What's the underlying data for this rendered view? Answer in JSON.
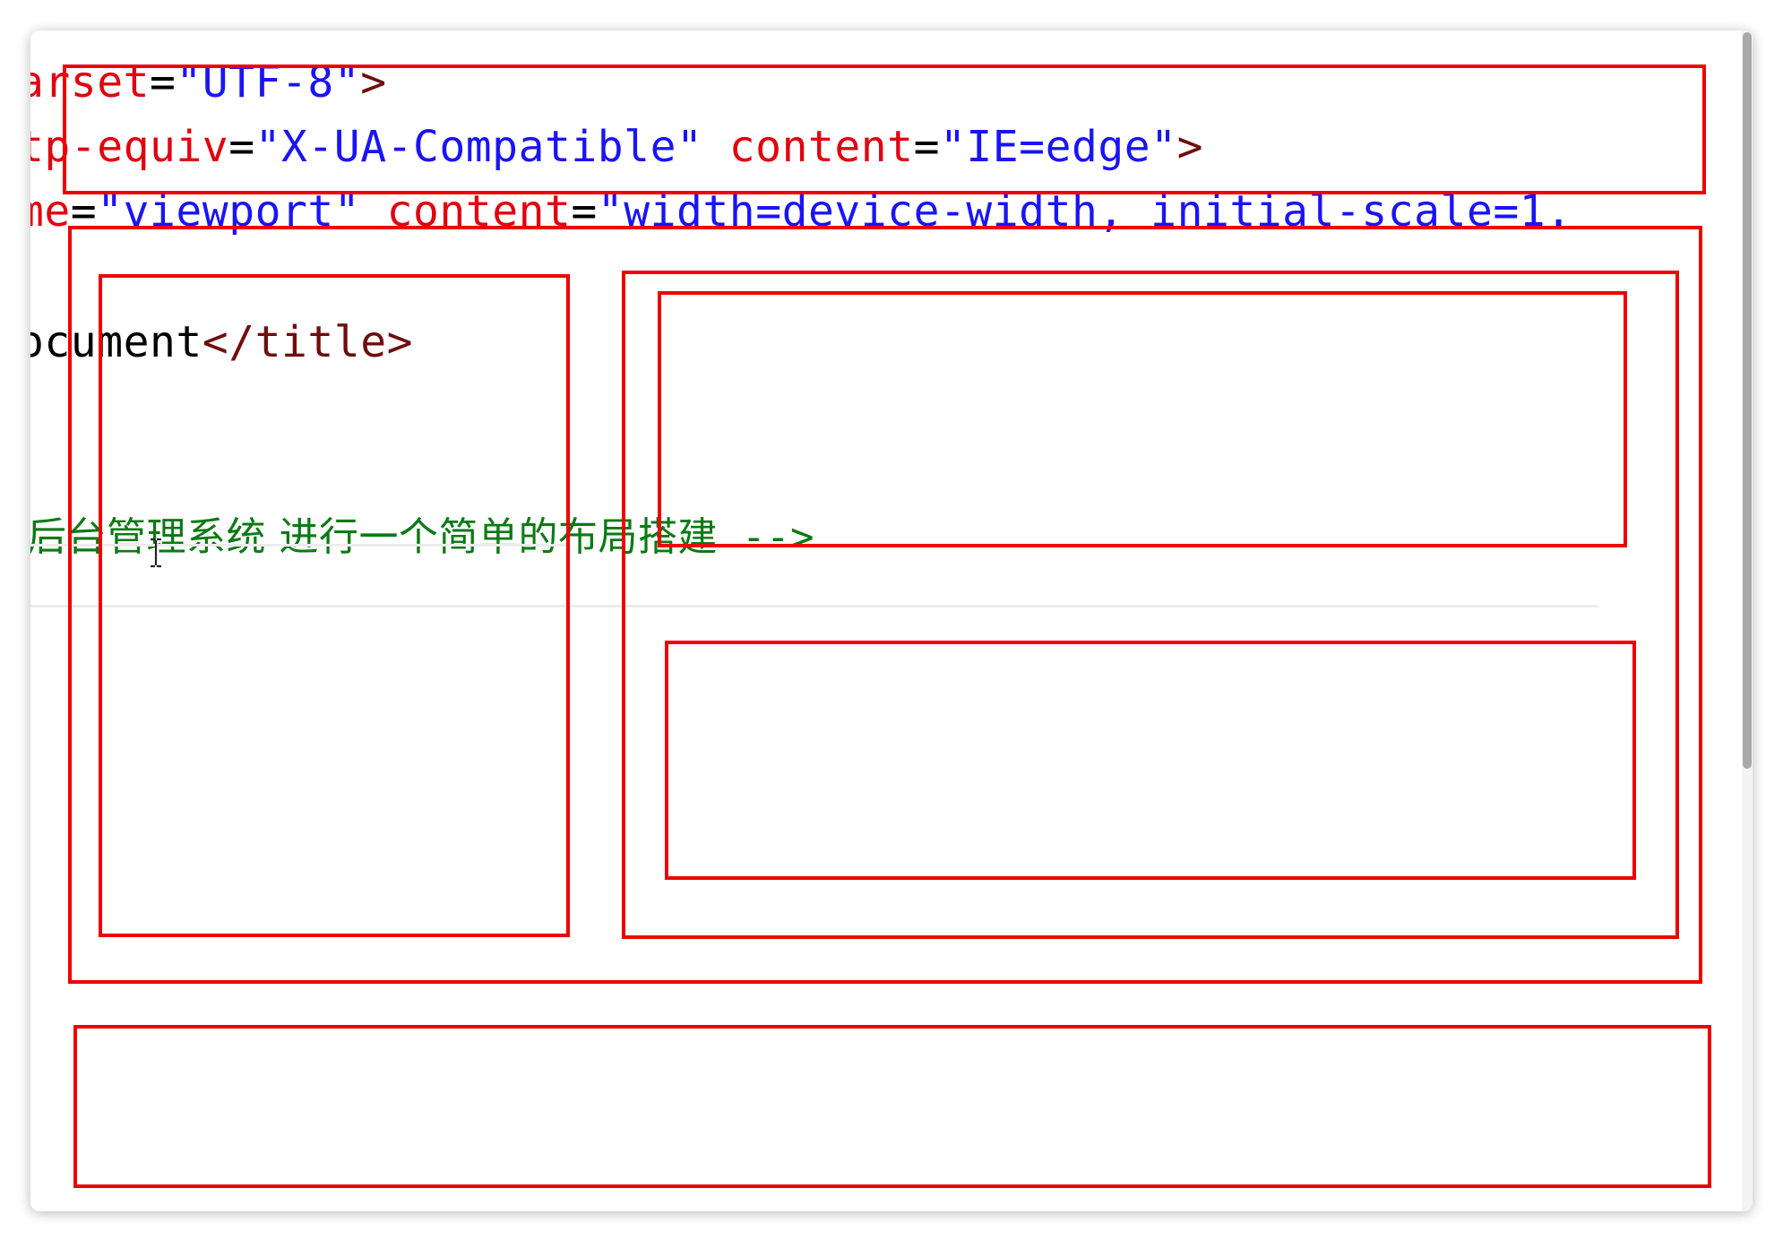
{
  "editor": {
    "line1": {
      "attr": "arset",
      "eq": "=",
      "value": "\"UTF-8\"",
      "close": ">"
    },
    "line2": {
      "attr1": "tp-equiv",
      "eq1": "=",
      "value1": "\"X-UA-Compatible\"",
      "attr2": "content",
      "eq2": "=",
      "value2": "\"IE=edge\"",
      "close": ">"
    },
    "line3": {
      "attr1": "me",
      "eq1": "=",
      "value1": "\"viewport\"",
      "attr2": "content",
      "eq2": "=",
      "value2": "\"width=device-width, initial-scale=1."
    },
    "line4": {
      "text": "ocument",
      "close_tag": "</title>"
    },
    "comment_line": {
      "text": "后台管理系统 进行一个简单的布局搭建",
      "end": " -->"
    }
  },
  "colors": {
    "layout_box_border": "#ee0000",
    "attribute": "#e1000f",
    "string": "#1a14f5",
    "tag": "#6e0e0e",
    "comment": "#0b7a14"
  },
  "icons": {
    "text_cursor": "i-beam-cursor-icon"
  }
}
